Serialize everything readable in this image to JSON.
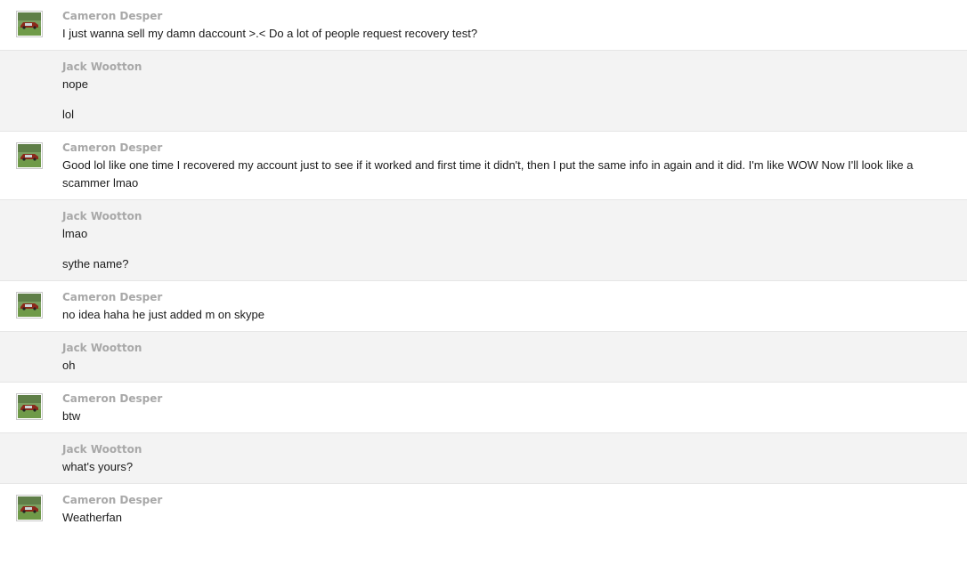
{
  "conversation": {
    "messages": [
      {
        "sender": "Cameron Desper",
        "avatar": "car-photo-avatar",
        "background": "#ffffff",
        "lines": [
          "I just wanna sell my damn daccount >.< Do a lot of people request recovery test?"
        ]
      },
      {
        "sender": "Jack Wootton",
        "avatar": "",
        "background": "#f3f3f3",
        "lines": [
          "nope",
          "lol"
        ]
      },
      {
        "sender": "Cameron Desper",
        "avatar": "car-photo-avatar",
        "background": "#ffffff",
        "lines": [
          "Good lol like one time I recovered my account just to see if it worked and first time it didn't, then I put the same info in again and it did. I'm like WOW Now I'll look like a scammer lmao"
        ]
      },
      {
        "sender": "Jack Wootton",
        "avatar": "",
        "background": "#f3f3f3",
        "lines": [
          "lmao",
          "sythe name?"
        ]
      },
      {
        "sender": "Cameron Desper",
        "avatar": "car-photo-avatar",
        "background": "#ffffff",
        "lines": [
          "no idea haha he just added m on skype"
        ]
      },
      {
        "sender": "Jack Wootton",
        "avatar": "",
        "background": "#f3f3f3",
        "lines": [
          "oh"
        ]
      },
      {
        "sender": "Cameron Desper",
        "avatar": "car-photo-avatar",
        "background": "#ffffff",
        "lines": [
          "btw"
        ]
      },
      {
        "sender": "Jack Wootton",
        "avatar": "",
        "background": "#f3f3f3",
        "lines": [
          "what's yours?"
        ]
      },
      {
        "sender": "Cameron Desper",
        "avatar": "car-photo-avatar",
        "background": "#ffffff",
        "lines": [
          "Weatherfan"
        ]
      }
    ]
  },
  "colors": {
    "sender_name": "#a8a8a8",
    "message_text": "#1a1a1a",
    "row_white": "#ffffff",
    "row_gray": "#f3f3f3",
    "divider": "#e6e6e6"
  }
}
